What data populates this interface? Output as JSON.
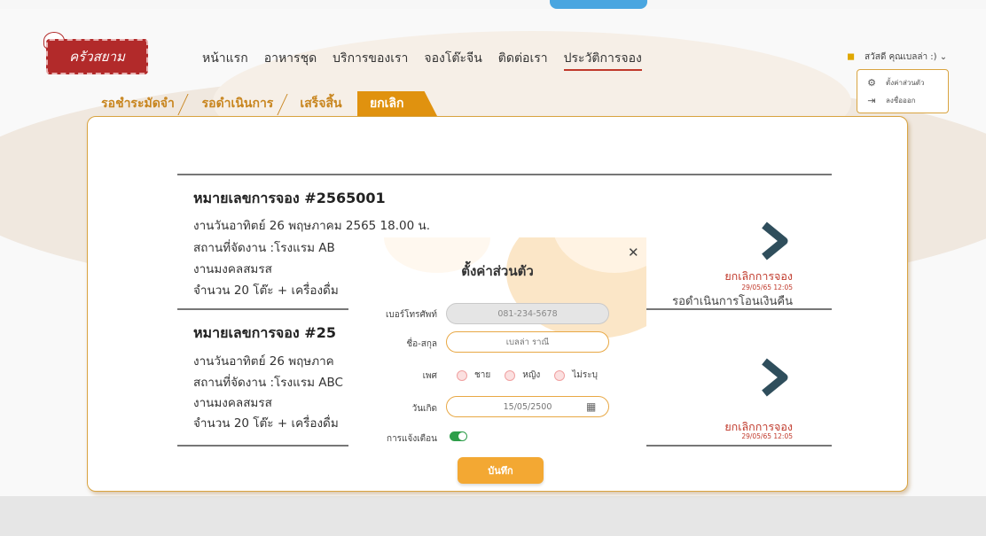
{
  "colors": {
    "accent": "#e0920f",
    "brand_red": "#b22a2a",
    "status_red": "#c0392b",
    "toggle_green": "#2e9e4a"
  },
  "brand": {
    "logo_text": "ครัวสยาม"
  },
  "nav": {
    "items": [
      "หน้าแรก",
      "อาหารชุด",
      "บริการของเรา",
      "จองโต๊ะจีน",
      "ติดต่อเรา",
      "ประวัติการจอง"
    ],
    "active": "ประวัติการจอง"
  },
  "user": {
    "greeting": "สวัสดี คุณเบลล่า :)",
    "menu": [
      {
        "icon": "gear-icon",
        "label": "ตั้งค่าส่วนตัว"
      },
      {
        "icon": "logout-icon",
        "label": "ลงชื่อออก"
      }
    ]
  },
  "tabs": [
    "รอชำระมัดจำ",
    "รอดำเนินการ",
    "เสร็จสิ้น",
    "ยกเลิก"
  ],
  "active_tab": "ยกเลิก",
  "bookings": [
    {
      "title": "หมายเลขการจอง #2565001",
      "date_line": "งานวันอาทิตย์ 26 พฤษภาคม 2565 18.00 น.",
      "venue_line": "สถานที่จัดงาน :โรงแรม AB",
      "event_line": "งานมงคลสมรส",
      "qty_line": "จำนวน 20 โต๊ะ + เครื่องดื่ม",
      "status": "ยกเลิกการจอง",
      "status_date": "29/05/65 12:05",
      "status_note": "รอดำเนินการโอนเงินคืน"
    },
    {
      "title": "หมายเลขการจอง #25",
      "date_line": "งานวันอาทิตย์ 26 พฤษภาค",
      "venue_line": "สถานที่จัดงาน :โรงแรม ABC",
      "event_line": "งานมงคลสมรส",
      "qty_line": "จำนวน 20 โต๊ะ + เครื่องดื่ม",
      "status": "ยกเลิกการจอง",
      "status_date": "29/05/65 12:05"
    }
  ],
  "modal": {
    "title": "ตั้งค่าส่วนตัว",
    "phone_label": "เบอร์โทรศัพท์",
    "phone_value": "081-234-5678",
    "name_label": "ชื่อ-สกุล",
    "name_placeholder": "เบลล่า ราณี",
    "gender_label": "เพศ",
    "gender_options": [
      "ชาย",
      "หญิง",
      "ไม่ระบุ"
    ],
    "birthday_label": "วันเกิด",
    "birthday_value": "15/05/2500",
    "notify_label": "การแจ้งเตือน",
    "notify_on": true,
    "save_label": "บันทึก"
  }
}
